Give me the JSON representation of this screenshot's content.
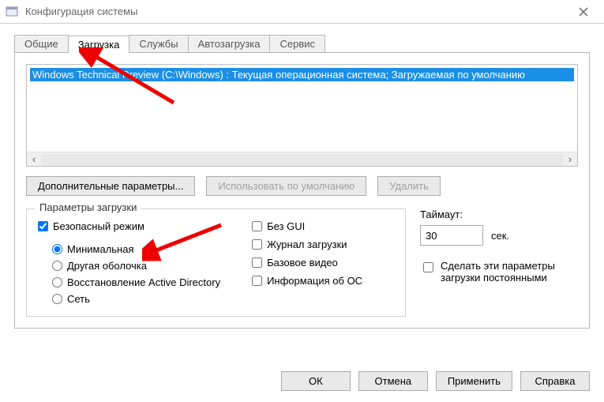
{
  "window": {
    "title": "Конфигурация системы"
  },
  "tabs": {
    "t0": "Общие",
    "t1": "Загрузка",
    "t2": "Службы",
    "t3": "Автозагрузка",
    "t4": "Сервис"
  },
  "boot_list": {
    "row0": "Windows Technical Preview (C:\\Windows) : Текущая операционная система; Загружаемая по умолчанию"
  },
  "buttons": {
    "advanced": "Дополнительные параметры...",
    "set_default": "Использовать по умолчанию",
    "delete": "Удалить",
    "ok": "ОК",
    "cancel": "Отмена",
    "apply": "Применить",
    "help": "Справка"
  },
  "boot_options": {
    "group_title": "Параметры загрузки",
    "safe_mode": "Безопасный режим",
    "minimal": "Минимальная",
    "alt_shell": "Другая оболочка",
    "ad_repair": "Восстановление Active Directory",
    "network": "Сеть",
    "no_gui": "Без GUI",
    "boot_log": "Журнал загрузки",
    "base_video": "Базовое видео",
    "os_info": "Информация  об ОС"
  },
  "timeout": {
    "label": "Таймаут:",
    "value": "30",
    "suffix": "сек."
  },
  "persist": {
    "label": "Сделать эти параметры загрузки постоянными"
  }
}
